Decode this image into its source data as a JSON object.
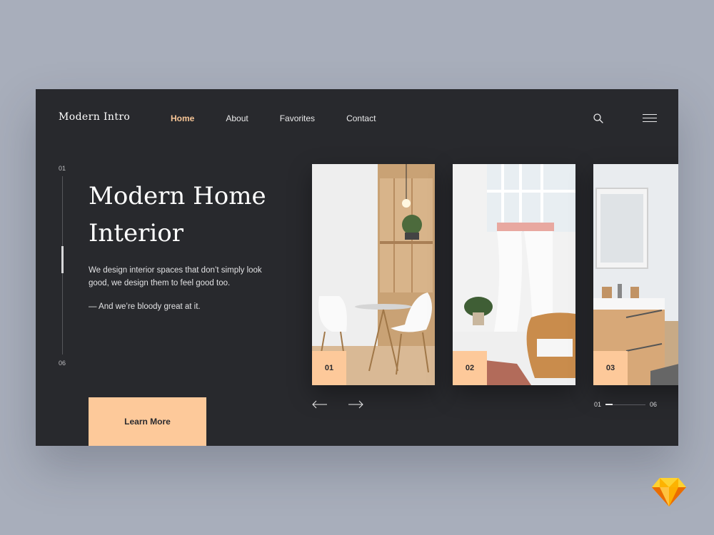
{
  "header": {
    "logo": "Modern Intro",
    "nav": [
      "Home",
      "About",
      "Favorites",
      "Contact"
    ],
    "active_nav": "Home"
  },
  "hero": {
    "index_start": "01",
    "index_end": "06",
    "title": "Modern Home Interior",
    "description": "We design interior spaces that don’t simply look good, we design them to feel good too.",
    "tagline": "— And we’re bloody great at it.",
    "cta": "Learn More"
  },
  "cards": [
    {
      "number": "01"
    },
    {
      "number": "02"
    },
    {
      "number": "03"
    }
  ],
  "pager": {
    "start": "01",
    "end": "06"
  },
  "colors": {
    "accent": "#fdc99a",
    "panel": "#28292d",
    "background": "#a8aebb"
  }
}
